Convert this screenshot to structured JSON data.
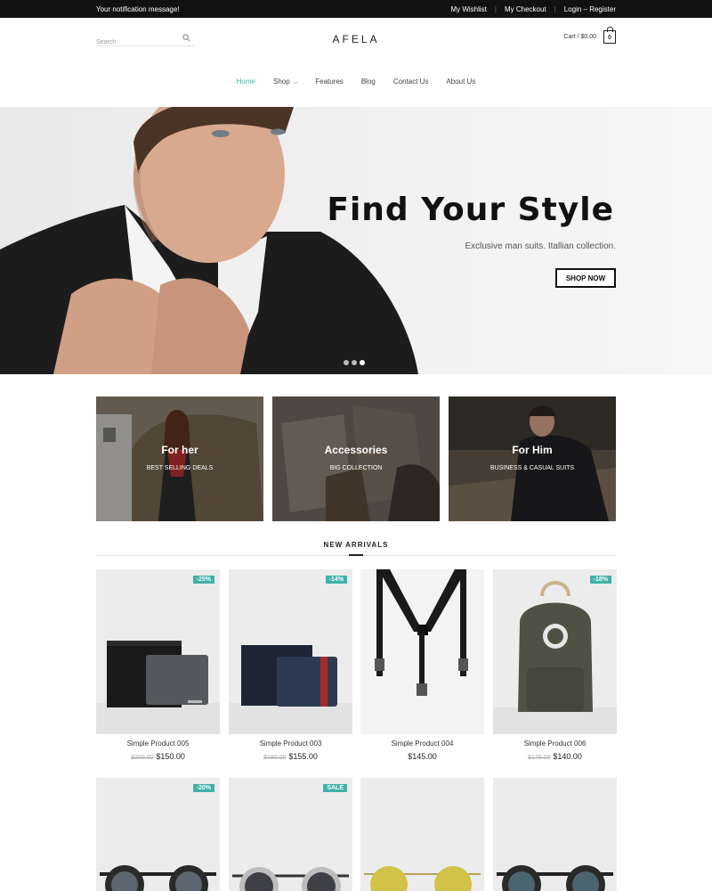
{
  "topbar": {
    "notification": "Your notification message!",
    "links": [
      "My Wishlist",
      "My Checkout",
      "Login – Register"
    ]
  },
  "header": {
    "search_placeholder": "Search",
    "logo": "AFELA",
    "cart_label": "Cart / $0.00",
    "cart_count": "0"
  },
  "nav": {
    "items": [
      "Home",
      "Shop",
      "Features",
      "Blog",
      "Contact Us",
      "About Us"
    ],
    "active": "Home"
  },
  "hero": {
    "title": "Find Your Style",
    "subtitle": "Exclusive man suits. Itallian collection.",
    "button": "SHOP NOW",
    "slides": 3,
    "active_slide": 3
  },
  "banners": [
    {
      "title": "For her",
      "subtitle": "BEST SELLING DEALS"
    },
    {
      "title": "Accessories",
      "subtitle": "BIG COLLECTION"
    },
    {
      "title": "For Him",
      "subtitle": "BUSINESS & CASUAL SUITS"
    }
  ],
  "new_arrivals": {
    "title": "NEW ARRIVALS",
    "products": [
      {
        "name": "Simple Product 005",
        "old_price": "$200.00",
        "price": "$150.00",
        "badge": "-25%"
      },
      {
        "name": "Simple Product 003",
        "old_price": "$180.00",
        "price": "$155.00",
        "badge": "-14%"
      },
      {
        "name": "Simple Product 004",
        "old_price": "",
        "price": "$145.00",
        "badge": ""
      },
      {
        "name": "Simple Product 006",
        "old_price": "$170.00",
        "price": "$140.00",
        "badge": "-18%"
      }
    ],
    "row2_badges": [
      "-20%",
      "SALE",
      "",
      ""
    ]
  },
  "colors": {
    "accent": "#3fb1a9",
    "topbar_bg": "#111111"
  }
}
